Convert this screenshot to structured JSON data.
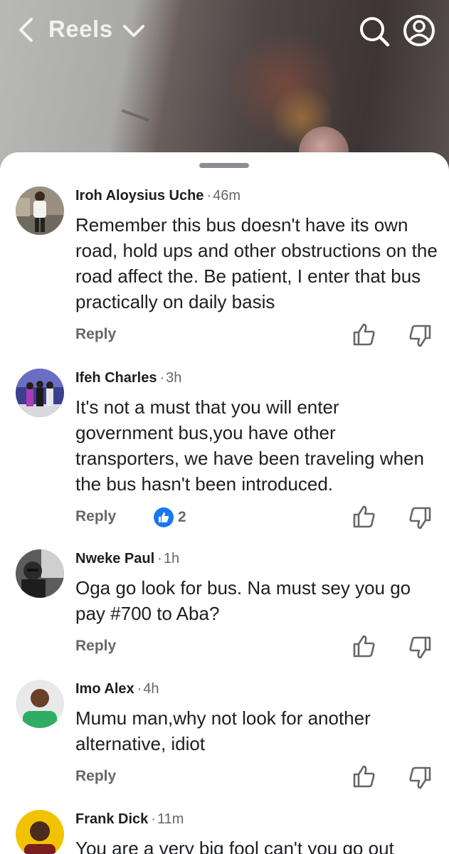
{
  "header": {
    "title": "Reels",
    "icons": [
      "chevron-left-icon",
      "chevron-down-icon",
      "search-icon",
      "profile-icon"
    ]
  },
  "comments": [
    {
      "author": "Iroh Aloysius Uche",
      "time": "46m",
      "text": "Remember this bus doesn't have its own road, hold ups and other obstructions on the road affect the. Be patient, I enter that bus practically on daily basis",
      "reply_label": "Reply"
    },
    {
      "author": "Ifeh Charles",
      "time": "3h",
      "text": "It's not a must that you will enter government bus,you have other transporters, we have been traveling when the bus hasn't been introduced.",
      "reply_label": "Reply",
      "reaction_count": "2"
    },
    {
      "author": "Nweke Paul",
      "time": "1h",
      "text": "Oga go look for bus. Na must sey you go pay #700 to Aba?",
      "reply_label": "Reply"
    },
    {
      "author": "Imo Alex",
      "time": "4h",
      "text": "Mumu man,why not look for another alternative, idiot",
      "reply_label": "Reply"
    },
    {
      "author": "Frank Dick",
      "time": "11m",
      "text": "You are a very big fool can't you go out"
    }
  ],
  "colors": {
    "accent": "#1877f2",
    "secondary_text": "#65676b",
    "primary_text": "#1c1e21"
  }
}
